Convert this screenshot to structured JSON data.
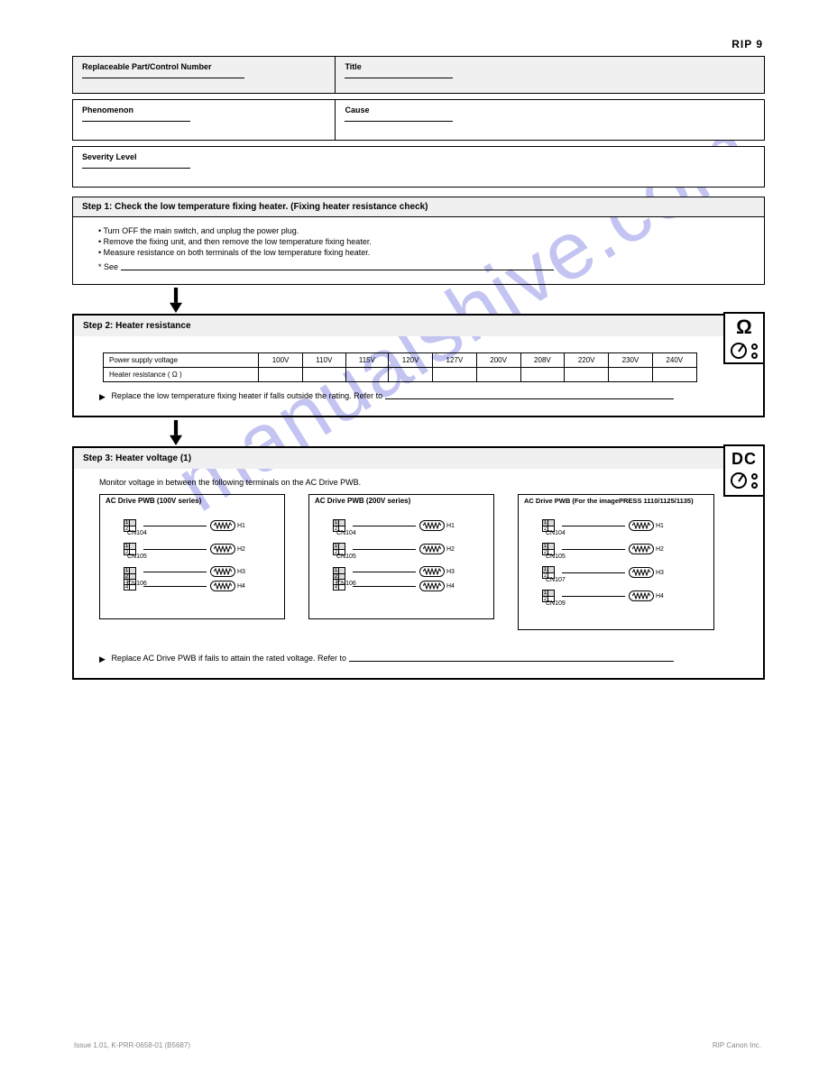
{
  "page_code": "RIP 9",
  "watermark": "manualshive.com",
  "header": {
    "control_title": "Replaceable Part/Control Number",
    "title_label": "Title",
    "phenom": "Phenomenon",
    "cause": "Cause",
    "severity": "Severity Level"
  },
  "step1": {
    "title": "Step 1:  Check the low temperature fixing heater. (Fixing heater resistance check)",
    "bullets": [
      "Turn OFF the main switch, and unplug the power plug.",
      "Remove the fixing unit, and then remove the low temperature fixing heater.",
      "Measure resistance on both terminals of the low temperature fixing heater."
    ],
    "see_prefix": "* See"
  },
  "step2": {
    "title": "Step 2:  Heater resistance",
    "table": {
      "voltage": "Power supply voltage",
      "resist": "Heater resistance (   )",
      "cols": [
        "100V",
        "110V",
        "115V",
        "120V",
        "127V",
        "200V",
        "208V",
        "220V",
        "230V",
        "240V"
      ]
    },
    "replace_prefix": "Replace the low temperature fixing heater if falls outside the rating.  Refer to"
  },
  "step3": {
    "title": "Step 3:  Heater voltage (1)",
    "desc": "Monitor voltage in between the following terminals on the AC Drive PWB.",
    "boxes": [
      {
        "name": "AC Drive PWB (100V series)",
        "connectors": [
          {
            "label": "CN104",
            "pins": [
              [
                "1S",
                "2"
              ]
            ],
            "heater": [
              "H1"
            ]
          },
          {
            "label": "CN105",
            "pins": [
              [
                "1S",
                "2"
              ]
            ],
            "heater": [
              "H2"
            ]
          },
          {
            "label": "CN106",
            "pins": [
              [
                "1S",
                "2S"
              ],
              [
                "3",
                "4"
              ]
            ],
            "heater": [
              "H3",
              "H4"
            ]
          }
        ]
      },
      {
        "name": "AC Drive PWB (200V series)",
        "connectors": [
          {
            "label": "CN104",
            "pins": [
              [
                "1S",
                "2"
              ]
            ],
            "heater": [
              "H1"
            ]
          },
          {
            "label": "CN105",
            "pins": [
              [
                "1S",
                "2"
              ]
            ],
            "heater": [
              "H2"
            ]
          },
          {
            "label": "CN106",
            "pins": [
              [
                "1S",
                "2S"
              ],
              [
                "3",
                "4"
              ]
            ],
            "heater": [
              "H3",
              "H4"
            ]
          }
        ]
      },
      {
        "name": "AC Drive PWB (For the imagePRESS 1110/1125/1135)",
        "connectors": [
          {
            "label": "CN104",
            "pins": [
              [
                "1S",
                "2"
              ]
            ],
            "heater": [
              "H1"
            ]
          },
          {
            "label": "CN105",
            "pins": [
              [
                "1S",
                "2"
              ]
            ],
            "heater": [
              "H2"
            ]
          },
          {
            "label": "CN107",
            "pins": [
              [
                "1S",
                "2"
              ]
            ],
            "heater": [
              "H3"
            ]
          },
          {
            "label": "CN109",
            "pins": [
              [
                "1S",
                "2"
              ]
            ],
            "heater": [
              "H4"
            ]
          }
        ]
      }
    ],
    "replace_prefix": "Replace AC Drive PWB if fails to attain the rated voltage.  Refer to"
  },
  "footer": {
    "left": "Issue 1.01, K-PRR-0658-01 (B5687)",
    "right": "RIP   Canon Inc."
  }
}
